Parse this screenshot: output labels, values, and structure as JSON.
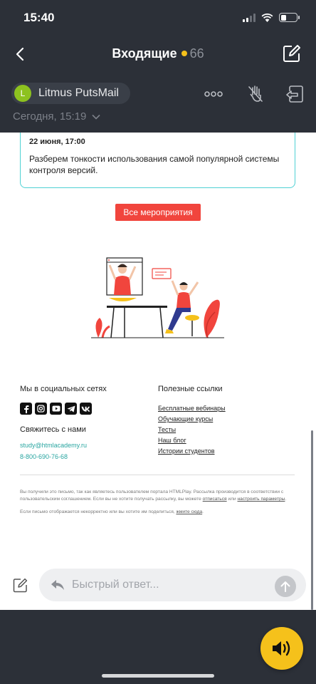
{
  "status_bar": {
    "time": "15:40",
    "battery_level": 0.35
  },
  "nav": {
    "title": "Входящие",
    "count": "66",
    "dot_color": "#f5c11b"
  },
  "sender": {
    "initial": "L",
    "name": "Litmus PutsMail",
    "avatar_color": "#8dc21f",
    "date": "Сегодня, 15:19"
  },
  "email": {
    "event": {
      "date": "22 июня, 17:00",
      "description": "Разберем тонкости использования самой популярной системы контроля версий."
    },
    "all_events_button": "Все мероприятия",
    "footer": {
      "social_heading": "Мы в социальных сетях",
      "social_icons": [
        "facebook-icon",
        "instagram-icon",
        "youtube-icon",
        "telegram-icon",
        "vk-icon"
      ],
      "contact_heading": "Свяжитесь с нами",
      "email": "study@htmlacademy.ru",
      "phone": "8-800-690-76-68",
      "links_heading": "Полезные ссылки",
      "links": [
        "Бесплатные вебинары",
        "Обучающие курсы",
        "Тесты",
        "Наш блог",
        "Истории студентов"
      ]
    },
    "legal": {
      "text1_a": "Вы получили это письмо, так как являетесь пользователем портала HTMLPlay. Рассылка производится в соответствии с пользовательским соглашением. Если вы не хотите получать рассылку, вы можете ",
      "unsubscribe": "отписаться",
      "text1_b": " или ",
      "settings": "настроить параметры",
      "text1_c": ".",
      "text2_a": "Если письмо отображается некорректно или вы хотите им поделиться, ",
      "click_here": "жмите сюда",
      "text2_b": "."
    }
  },
  "reply": {
    "placeholder": "Быстрый ответ..."
  },
  "colors": {
    "accent_red": "#f1453d",
    "teal": "#2aa6a1",
    "voice_button": "#f5c11b"
  }
}
